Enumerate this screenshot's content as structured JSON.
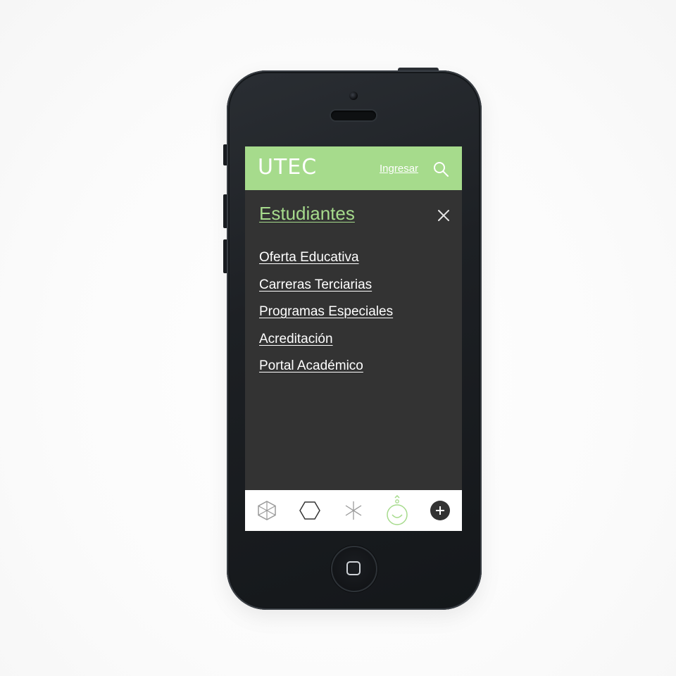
{
  "header": {
    "logo_text": "UTEC",
    "login_label": "Ingresar",
    "search_icon": "search-icon"
  },
  "menu": {
    "section_title": "Estudiantes",
    "close_icon": "close-icon",
    "items": [
      {
        "label": "Oferta Educativa"
      },
      {
        "label": "Carreras Terciarias"
      },
      {
        "label": "Programas Especiales"
      },
      {
        "label": "Acreditación"
      },
      {
        "label": "Portal Académico"
      }
    ]
  },
  "tabbar": {
    "tabs": [
      {
        "icon": "cube-icon",
        "active": false
      },
      {
        "icon": "hexagon-icon",
        "active": false
      },
      {
        "icon": "asterisk-icon",
        "active": false
      },
      {
        "icon": "smile-user-icon",
        "active": true
      },
      {
        "icon": "plus-circle-icon",
        "active": false
      }
    ]
  },
  "colors": {
    "accent": "#a6db8c",
    "screen_bg": "#333333",
    "tabbar_bg": "#ffffff",
    "icon_gray": "#9a9a9a",
    "icon_dark": "#333333"
  }
}
